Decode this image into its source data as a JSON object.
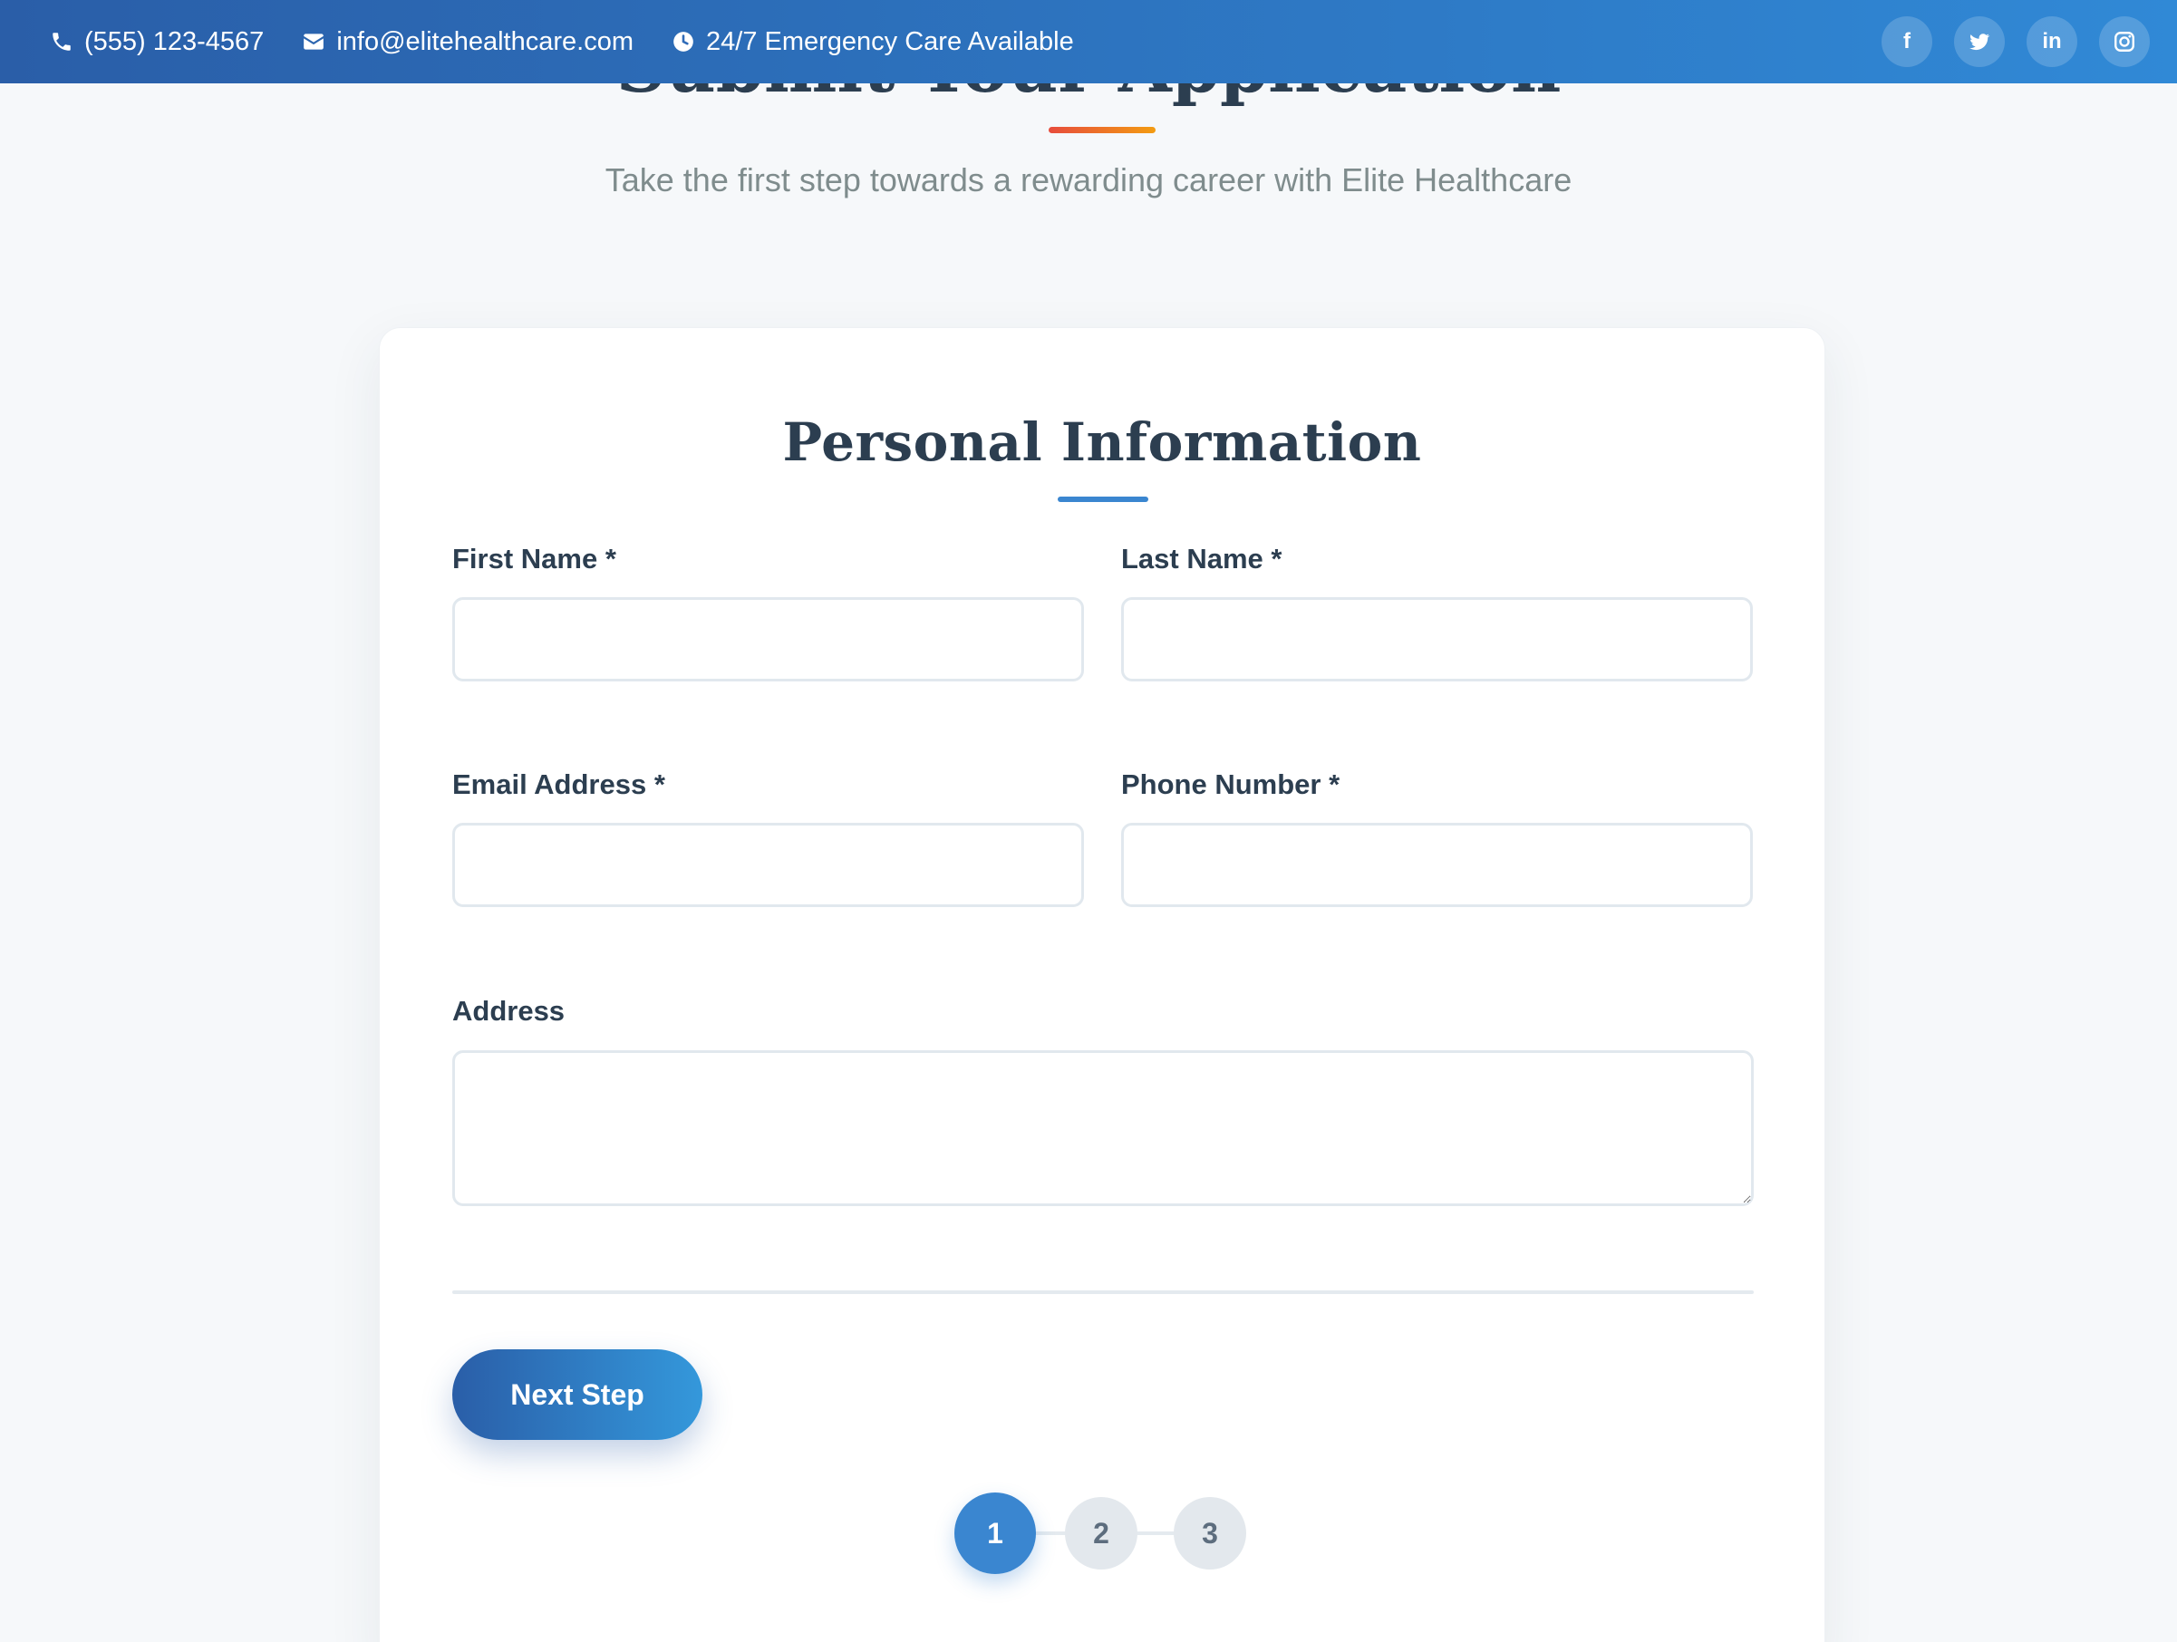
{
  "topbar": {
    "phone": "(555) 123-4567",
    "email": "info@elitehealthcare.com",
    "hours": "24/7 Emergency Care Available",
    "social": [
      {
        "icon": "facebook-icon",
        "label": "f"
      },
      {
        "icon": "twitter-icon",
        "label": ""
      },
      {
        "icon": "linkedin-icon",
        "label": "in"
      },
      {
        "icon": "instagram-icon",
        "label": ""
      }
    ]
  },
  "section": {
    "title": "Submit Your Application",
    "subtitle": "Take the first step towards a rewarding career with Elite Healthcare"
  },
  "form": {
    "title": "Personal Information",
    "fields": {
      "first_name": {
        "label": "First Name *",
        "value": ""
      },
      "last_name": {
        "label": "Last Name *",
        "value": ""
      },
      "email": {
        "label": "Email Address *",
        "value": ""
      },
      "phone": {
        "label": "Phone Number *",
        "value": ""
      },
      "address": {
        "label": "Address",
        "value": ""
      }
    },
    "next_label": "Next Step",
    "steps": [
      "1",
      "2",
      "3"
    ],
    "current_step": 1
  },
  "colors": {
    "brand_start": "#2a5ea8",
    "brand_end": "#3498db",
    "accent_start": "#e74c3c",
    "accent_end": "#f39c12"
  }
}
